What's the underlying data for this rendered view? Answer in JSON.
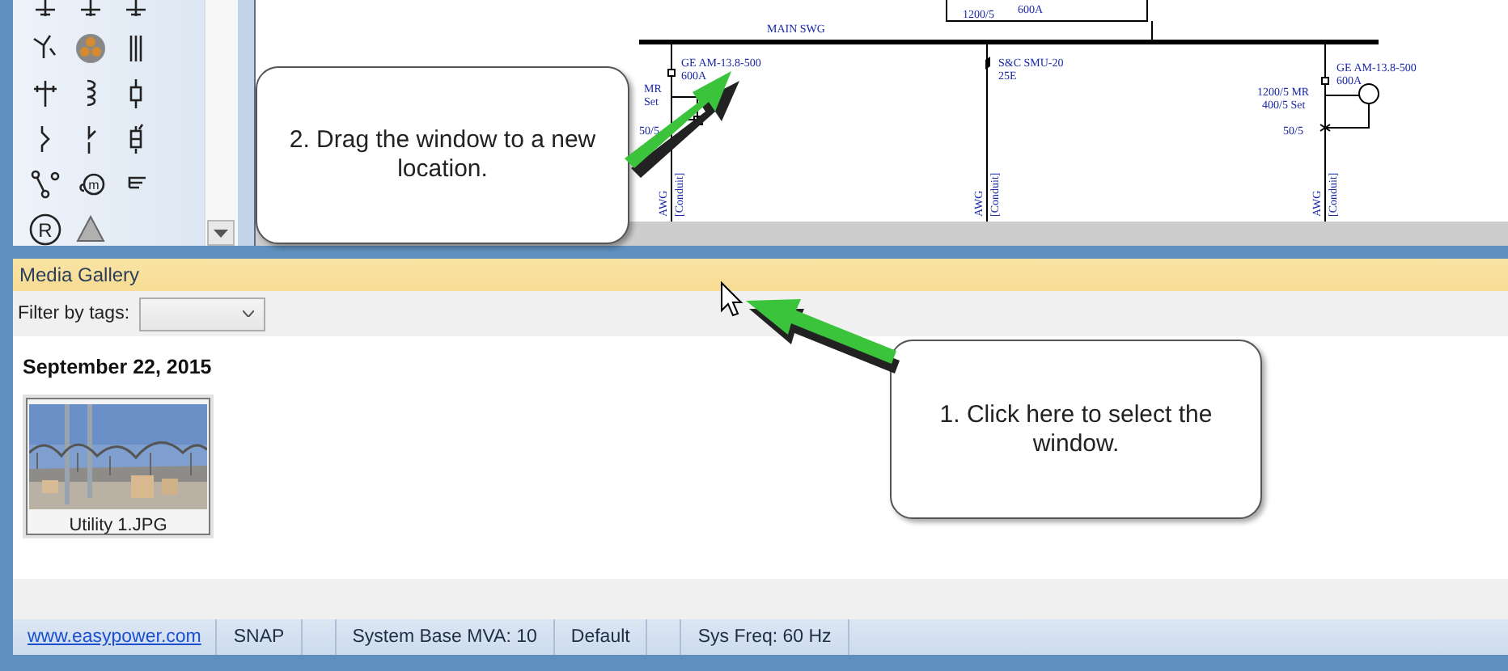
{
  "palette": {
    "items": [
      {
        "kind": "cut"
      },
      {
        "kind": "cut"
      },
      {
        "kind": "cut"
      },
      {
        "kind": "generator"
      },
      {
        "kind": "cable"
      },
      {
        "kind": "bars"
      },
      {
        "kind": "pole"
      },
      {
        "kind": "coil"
      },
      {
        "kind": "fuse"
      },
      {
        "kind": "switch"
      },
      {
        "kind": "disconnect"
      },
      {
        "kind": "fuselink"
      },
      {
        "kind": "nodes"
      },
      {
        "kind": "motor",
        "glyph": "m"
      },
      {
        "kind": "load"
      },
      {
        "kind": "utility",
        "glyph": "R"
      },
      {
        "kind": "triangle"
      }
    ]
  },
  "diagram": {
    "labels": [
      "1200/5",
      "600A",
      "MAIN SWG",
      "GE AM-13.8-500",
      "600A",
      "MR",
      "Set",
      "50/5",
      "S&C SMU-20",
      "25E",
      "GE AM-13.8-500",
      "600A",
      "1200/5 MR",
      "400/5 Set",
      "50/5",
      "AWG",
      "[Conduit]",
      "AWG",
      "[Conduit]",
      "AWG",
      "[Conduit]"
    ]
  },
  "callouts": [
    {
      "text": "2. Drag the window to a new location."
    },
    {
      "text": "1. Click here to select the window."
    }
  ],
  "gallery": {
    "title": "Media Gallery",
    "filter_label": "Filter by tags:",
    "groups": [
      {
        "date": "September 22, 2015",
        "items": [
          {
            "kind": "picture",
            "caption": "Utility 1.JPG"
          }
        ]
      }
    ]
  },
  "status_bar": [
    {
      "kind": "link",
      "text": "www.easypower.com"
    },
    {
      "kind": "text",
      "text": "SNAP"
    },
    {
      "kind": "empty"
    },
    {
      "kind": "text",
      "text": "System Base MVA: 10"
    },
    {
      "kind": "text",
      "text": "Default"
    },
    {
      "kind": "empty"
    },
    {
      "kind": "text",
      "text": "Sys Freq: 60 Hz"
    }
  ]
}
